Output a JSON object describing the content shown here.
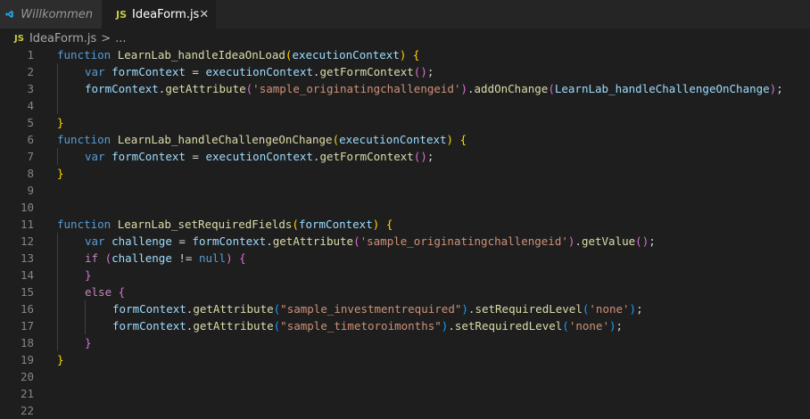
{
  "tabs": [
    {
      "label": "Willkommen",
      "icon": "vscode-icon",
      "active": false
    },
    {
      "label": "IdeaForm.js",
      "icon": "js-file-icon",
      "active": true,
      "close": "✕"
    }
  ],
  "breadcrumb": {
    "file": "IdeaForm.js",
    "separator": ">",
    "symbol": "..."
  },
  "js_badge": "JS",
  "editor": {
    "lines": [
      {
        "n": "1",
        "tokens": [
          [
            "kw",
            "function"
          ],
          [
            "pl",
            " "
          ],
          [
            "fn",
            "LearnLab_handleIdeaOnLoad"
          ],
          [
            "b1",
            "("
          ],
          [
            "var",
            "executionContext"
          ],
          [
            "b1",
            ")"
          ],
          [
            "pl",
            " "
          ],
          [
            "b1",
            "{"
          ]
        ]
      },
      {
        "n": "2",
        "indent": 1,
        "tokens": [
          [
            "kw",
            "var"
          ],
          [
            "pl",
            " "
          ],
          [
            "var",
            "formContext"
          ],
          [
            "pl",
            " = "
          ],
          [
            "var",
            "executionContext"
          ],
          [
            "pl",
            "."
          ],
          [
            "fn",
            "getFormContext"
          ],
          [
            "b2",
            "()"
          ],
          [
            "pl",
            ";"
          ]
        ]
      },
      {
        "n": "3",
        "indent": 1,
        "tokens": [
          [
            "var",
            "formContext"
          ],
          [
            "pl",
            "."
          ],
          [
            "fn",
            "getAttribute"
          ],
          [
            "b2",
            "("
          ],
          [
            "str",
            "'sample_originatingchallengeid'"
          ],
          [
            "b2",
            ")"
          ],
          [
            "pl",
            "."
          ],
          [
            "fn",
            "addOnChange"
          ],
          [
            "b2",
            "("
          ],
          [
            "var",
            "LearnLab_handleChallengeOnChange"
          ],
          [
            "b2",
            ")"
          ],
          [
            "pl",
            ";"
          ]
        ]
      },
      {
        "n": "4",
        "indent": 1,
        "tokens": []
      },
      {
        "n": "5",
        "tokens": [
          [
            "b1",
            "}"
          ]
        ]
      },
      {
        "n": "6",
        "tokens": [
          [
            "kw",
            "function"
          ],
          [
            "pl",
            " "
          ],
          [
            "fn",
            "LearnLab_handleChallengeOnChange"
          ],
          [
            "b1",
            "("
          ],
          [
            "var",
            "executionContext"
          ],
          [
            "b1",
            ")"
          ],
          [
            "pl",
            " "
          ],
          [
            "b1",
            "{"
          ]
        ]
      },
      {
        "n": "7",
        "indent": 1,
        "tokens": [
          [
            "kw",
            "var"
          ],
          [
            "pl",
            " "
          ],
          [
            "var",
            "formContext"
          ],
          [
            "pl",
            " = "
          ],
          [
            "var",
            "executionContext"
          ],
          [
            "pl",
            "."
          ],
          [
            "fn",
            "getFormContext"
          ],
          [
            "b2",
            "()"
          ],
          [
            "pl",
            ";"
          ]
        ]
      },
      {
        "n": "8",
        "tokens": [
          [
            "b1",
            "}"
          ]
        ]
      },
      {
        "n": "9",
        "tokens": []
      },
      {
        "n": "10",
        "tokens": []
      },
      {
        "n": "11",
        "tokens": [
          [
            "kw",
            "function"
          ],
          [
            "pl",
            " "
          ],
          [
            "fn",
            "LearnLab_setRequiredFields"
          ],
          [
            "b1",
            "("
          ],
          [
            "var",
            "formContext"
          ],
          [
            "b1",
            ")"
          ],
          [
            "pl",
            " "
          ],
          [
            "b1",
            "{"
          ]
        ]
      },
      {
        "n": "12",
        "indent": 1,
        "tokens": [
          [
            "kw",
            "var"
          ],
          [
            "pl",
            " "
          ],
          [
            "var",
            "challenge"
          ],
          [
            "pl",
            " = "
          ],
          [
            "var",
            "formContext"
          ],
          [
            "pl",
            "."
          ],
          [
            "fn",
            "getAttribute"
          ],
          [
            "b2",
            "("
          ],
          [
            "str",
            "'sample_originatingchallengeid'"
          ],
          [
            "b2",
            ")"
          ],
          [
            "pl",
            "."
          ],
          [
            "fn",
            "getValue"
          ],
          [
            "b2",
            "()"
          ],
          [
            "pl",
            ";"
          ]
        ]
      },
      {
        "n": "13",
        "indent": 1,
        "tokens": [
          [
            "kw2",
            "if"
          ],
          [
            "pl",
            " "
          ],
          [
            "b2",
            "("
          ],
          [
            "var",
            "challenge"
          ],
          [
            "pl",
            " != "
          ],
          [
            "kw",
            "null"
          ],
          [
            "b2",
            ")"
          ],
          [
            "pl",
            " "
          ],
          [
            "b2",
            "{"
          ]
        ]
      },
      {
        "n": "14",
        "indent": 1,
        "tokens": [
          [
            "b2",
            "}"
          ]
        ]
      },
      {
        "n": "15",
        "indent": 1,
        "tokens": [
          [
            "kw2",
            "else"
          ],
          [
            "pl",
            " "
          ],
          [
            "b2",
            "{"
          ]
        ]
      },
      {
        "n": "16",
        "indent": 2,
        "tokens": [
          [
            "var",
            "formContext"
          ],
          [
            "pl",
            "."
          ],
          [
            "fn",
            "getAttribute"
          ],
          [
            "b3",
            "("
          ],
          [
            "str",
            "\"sample_investmentrequired\""
          ],
          [
            "b3",
            ")"
          ],
          [
            "pl",
            "."
          ],
          [
            "fn",
            "setRequiredLevel"
          ],
          [
            "b3",
            "("
          ],
          [
            "str",
            "'none'"
          ],
          [
            "b3",
            ")"
          ],
          [
            "pl",
            ";"
          ]
        ]
      },
      {
        "n": "17",
        "indent": 2,
        "tokens": [
          [
            "var",
            "formContext"
          ],
          [
            "pl",
            "."
          ],
          [
            "fn",
            "getAttribute"
          ],
          [
            "b3",
            "("
          ],
          [
            "str",
            "\"sample_timetoroimonths\""
          ],
          [
            "b3",
            ")"
          ],
          [
            "pl",
            "."
          ],
          [
            "fn",
            "setRequiredLevel"
          ],
          [
            "b3",
            "("
          ],
          [
            "str",
            "'none'"
          ],
          [
            "b3",
            ")"
          ],
          [
            "pl",
            ";"
          ]
        ]
      },
      {
        "n": "18",
        "indent": 1,
        "tokens": [
          [
            "b2",
            "}"
          ]
        ]
      },
      {
        "n": "19",
        "tokens": [
          [
            "b1",
            "}"
          ]
        ]
      },
      {
        "n": "20",
        "tokens": []
      },
      {
        "n": "21",
        "tokens": []
      },
      {
        "n": "22",
        "tokens": []
      }
    ]
  },
  "colors": {
    "keyword": "#569cd6",
    "control_keyword": "#c586c0",
    "function": "#dcdcaa",
    "variable": "#9cdcfe",
    "string": "#ce9178",
    "bracket_level1": "#ffd700",
    "bracket_level2": "#da70d6",
    "bracket_level3": "#179fff"
  }
}
